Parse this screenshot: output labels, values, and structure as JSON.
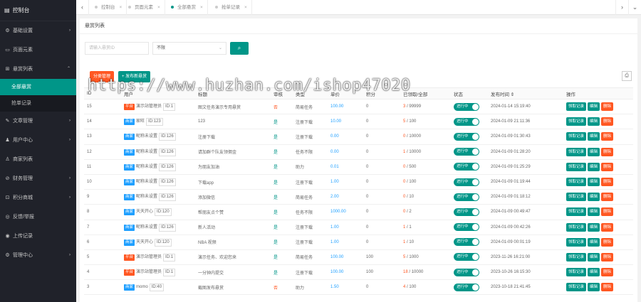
{
  "sidebar": {
    "logo": "控制台",
    "items": [
      {
        "label": "基础设置",
        "icon": "gear-icon",
        "glyph": "⚙",
        "arrow": "›"
      },
      {
        "label": "页面元素",
        "icon": "layers-icon",
        "glyph": "▭",
        "arrow": ""
      },
      {
        "label": "悬赏列表",
        "icon": "grid-icon",
        "glyph": "⊞",
        "arrow": "⌃",
        "expanded": true,
        "children": [
          {
            "label": "全部悬赏",
            "active": true
          },
          {
            "label": "抢单记录",
            "active": false
          }
        ]
      },
      {
        "label": "文章管理",
        "icon": "document-icon",
        "glyph": "✎",
        "arrow": "›"
      },
      {
        "label": "用户中心",
        "icon": "users-icon",
        "glyph": "♟",
        "arrow": "›"
      },
      {
        "label": "商家列表",
        "icon": "user-icon",
        "glyph": "♙",
        "arrow": ""
      },
      {
        "label": "财务管理",
        "icon": "finance-icon",
        "glyph": "⊘",
        "arrow": "›"
      },
      {
        "label": "积分商城",
        "icon": "cart-icon",
        "glyph": "⊡",
        "arrow": "›"
      },
      {
        "label": "反馈/举报",
        "icon": "feedback-icon",
        "glyph": "◎",
        "arrow": ""
      },
      {
        "label": "上传记录",
        "icon": "upload-icon",
        "glyph": "◉",
        "arrow": ""
      },
      {
        "label": "管理中心",
        "icon": "settings-icon",
        "glyph": "⚙",
        "arrow": "›"
      }
    ]
  },
  "tabs": {
    "prev": "‹",
    "next": "›",
    "more": "⌄",
    "items": [
      {
        "label": "控制台",
        "active": false
      },
      {
        "label": "页面元素",
        "active": false
      },
      {
        "label": "全部悬赏",
        "active": true
      },
      {
        "label": "抢单记录",
        "active": false
      }
    ],
    "close": "×"
  },
  "main": {
    "title": "悬赏列表",
    "filter": {
      "user_placeholder": "请输入悬赏ID",
      "select_value": "不限",
      "select_arrow": "⌄",
      "search_glyph": "⌕"
    },
    "buttons": {
      "category": "分类管理",
      "publish": "+ 发布新悬赏"
    },
    "print_glyph": "⎙",
    "columns": [
      "ID",
      "用户",
      "标题",
      "审核",
      "类型",
      "单价",
      "积分",
      "已领取/全部",
      "状态",
      "发布时间 ⇕",
      "操作"
    ],
    "status_label": "进行中",
    "actions": {
      "claim": "领取记录",
      "edit": "编辑",
      "delete": "删除"
    },
    "rows": [
      {
        "id": "15",
        "badge": "平台",
        "badge_type": "red",
        "user": "演示站管理员",
        "uid": "ID:1",
        "title": "图文任务演示专用悬赏",
        "audit": "否",
        "type": "简易任务",
        "price": "100.00",
        "points": "0",
        "claimed": "3",
        "total": "99999",
        "time": "2024-01-14 15:19:40"
      },
      {
        "id": "14",
        "badge": "商家",
        "badge_type": "blue",
        "user": "家旺",
        "uid": "ID:123",
        "title": "123",
        "audit": "是",
        "type": "注册下载",
        "price": "10.00",
        "points": "0",
        "claimed": "5",
        "total": "100",
        "time": "2024-01-09 21:11:36"
      },
      {
        "id": "13",
        "badge": "商家",
        "badge_type": "blue",
        "user": "昵称未设置",
        "uid": "ID:126",
        "title": "注册下载",
        "audit": "是",
        "type": "注册下载",
        "price": "0.00",
        "points": "0",
        "claimed": "0",
        "total": "10000",
        "time": "2024-01-09 01:30:43"
      },
      {
        "id": "12",
        "badge": "商家",
        "badge_type": "blue",
        "user": "昵称未设置",
        "uid": "ID:126",
        "title": "请加群个队友领佣金",
        "audit": "是",
        "type": "任务不限",
        "price": "0.00",
        "points": "0",
        "claimed": "1",
        "total": "10000",
        "time": "2024-01-09 01:28:20"
      },
      {
        "id": "11",
        "badge": "商家",
        "badge_type": "blue",
        "user": "昵称未设置",
        "uid": "ID:126",
        "title": "为朋友加油",
        "audit": "是",
        "type": "助力",
        "price": "0.01",
        "points": "0",
        "claimed": "0",
        "total": "500",
        "time": "2024-01-09 01:25:29"
      },
      {
        "id": "10",
        "badge": "商家",
        "badge_type": "blue",
        "user": "昵称未设置",
        "uid": "ID:126",
        "title": "下载app",
        "audit": "是",
        "type": "注册下载",
        "price": "1.00",
        "points": "0",
        "claimed": "0",
        "total": "100",
        "time": "2024-01-09 01:19:44"
      },
      {
        "id": "9",
        "badge": "商家",
        "badge_type": "blue",
        "user": "昵称未设置",
        "uid": "ID:126",
        "title": "添加微信",
        "audit": "是",
        "type": "简易任务",
        "price": "2.00",
        "points": "0",
        "claimed": "0",
        "total": "10",
        "time": "2024-01-09 01:18:12"
      },
      {
        "id": "8",
        "badge": "商家",
        "badge_type": "blue",
        "user": "天天开心",
        "uid": "ID:120",
        "title": "帮朋友点个赞",
        "audit": "是",
        "type": "任务不限",
        "price": "1000.00",
        "points": "0",
        "claimed": "0",
        "total": "2",
        "time": "2024-01-09 00:49:47"
      },
      {
        "id": "7",
        "badge": "商家",
        "badge_type": "blue",
        "user": "昵称未设置",
        "uid": "ID:126",
        "title": "新人活动",
        "audit": "是",
        "type": "注册下载",
        "price": "1.00",
        "points": "0",
        "claimed": "1",
        "total": "1",
        "time": "2024-01-09 00:42:26"
      },
      {
        "id": "6",
        "badge": "商家",
        "badge_type": "blue",
        "user": "天天开心",
        "uid": "ID:120",
        "title": "NBA 视频",
        "audit": "是",
        "type": "注册下载",
        "price": "1.00",
        "points": "0",
        "claimed": "1",
        "total": "10",
        "time": "2024-01-09 00:01:19"
      },
      {
        "id": "5",
        "badge": "平台",
        "badge_type": "red",
        "user": "演示站管理员",
        "uid": "ID:1",
        "title": "演示任务、欢迎您来",
        "audit": "是",
        "type": "简易任务",
        "price": "100.00",
        "points": "100",
        "claimed": "5",
        "total": "1000",
        "time": "2023-11-26 16:21:00"
      },
      {
        "id": "4",
        "badge": "平台",
        "badge_type": "red",
        "user": "演示站管理员",
        "uid": "ID:1",
        "title": "一分钟内提交",
        "audit": "是",
        "type": "注册下载",
        "price": "100.00",
        "points": "100",
        "claimed": "18",
        "total": "10000",
        "time": "2023-10-26 16:15:30"
      },
      {
        "id": "3",
        "badge": "商家",
        "badge_type": "blue",
        "user": "momo",
        "uid": "ID:40",
        "title": "截图发布悬赏",
        "audit": "否",
        "type": "助力",
        "price": "1.50",
        "points": "0",
        "claimed": "4",
        "total": "100",
        "time": "2023-10-18 21:41:45"
      }
    ]
  },
  "watermark": "https://www.huzhan.com/ishop47020"
}
